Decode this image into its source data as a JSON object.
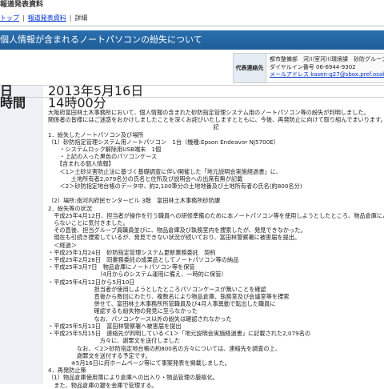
{
  "header": {
    "site_title": "報道発表資料",
    "breadcrumb": [
      "トップ",
      "報道発表資料",
      "詳細"
    ]
  },
  "page_title": "個人情報が含まれるノートパソコンの紛失について",
  "contact": {
    "label": "代表連絡先",
    "lines": [
      "都市整備部　河川室河川環境課　砂防グループ",
      "ダイヤルイン番号 06-6944-9302",
      "メールアドレス kasen-g27@sbox.pref.osaka.lg.jp"
    ]
  },
  "meta": {
    "date_label": "日",
    "date_value": "2013年5月16日",
    "time_label": "時間",
    "time_value": "14時00分"
  },
  "content": [
    "大阪府富田林土木事務所において、個人情報の含まれた砂防指定管理システム用のノートパソコン等の紛失が判明しました。",
    "関係者の皆様にはご迷惑をおかけしましたことを深くお詫びいたしますとともに、今後、再発防止に向けて取り組んでまいります。",
    "記",
    "1．紛失したノートパソコン及び場所",
    "（1）砂防指定管理システム用ノートパソコン　1台（機種:Epson Endeavor NJ5700E）",
    "　　・システムロック解除用USB端末　1個",
    "　　・上記の入った黒色のパソコンケース",
    "　　【含まれる個人情報】",
    "　　＜1＞土砂災害防止法に基づく基礎調査に伴い開催した「地元説明会実施経過書」に、",
    "　　　　土地所有者2,079名分の氏名と住所及び説明会への出席有無が記載",
    "　　＜2＞砂防指定地台帳のデータ中、約2,100筆分の土地地番及び土地所有者の氏名(約800名分)",
    "",
    "（2）場所:南河内府民センタービル 3階　富田林土木事務所砂防課",
    "2．紛失等の状況",
    "　平成25年4月12日、担当者が操作を行う職員への研修準備のために本ノートパソコン等を使用しようとしたところ、物品倉庫にパソコンケースが見当た",
    "　らないことに気付きました。",
    "　その直後、担当グループ員職員並びに、物品倉庫及び執務室内を捜索したが、発見できなかった。",
    "　現在も引続き捜索しているが、発見できない状況が続いており、富田林警察署に被害届を提出。",
    "　＜経過＞",
    "・平成25年1月24日　砂防指定管理システム更新業務委託　契約",
    "・平成25年2月28日　同業務委託の成果品としてノートパソコン等の納品",
    "・平成25年3月7日　物品倉庫にノートパソコン等を保管",
    "　　　　　　　　　（4月からのシステム運用に備え、一時的に保管）",
    "・平成25年4月12日から5月10日",
    "　　　　　　　　担当者が使用しようとしたところパソコンケースが無いことを確認",
    "　　　　　　　　直後から数回にわたり、複数名により物品倉庫、執務室及び会議室等を捜索",
    "　　　　　　　　併せて、富田林土木事務所所管職員及び4月人事異動で転出した職員に",
    "　　　　　　　　確認するも紛失物の発見に至らなかった",
    "　　　　　　　　なお、パソコンケース以外の紛失は確認されなかった",
    "・平成25年5月13日　富田林警察署へ被害届を提出",
    "・平成25年5月15日　連絡先が判明している＜1＞「地元説明会実施経過書」に記載された2,079名の",
    "　　　　　　　　　方々に、謝罪文を送付しました",
    "　　　　　なお、＜2＞砂防指定地台帳の約800名の方々については、連絡先を調査の上、",
    "　　　　　謝罪文を送付する予定です。",
    "　　　　※5月16日に府ホームページ等にて事案発表を掲載しました。",
    "4．再発防止策",
    "（1）物品倉庫使用簿により倉庫への出入り・物品管理の厳格化。",
    "　また、物品倉庫の鍵を金庫で管理する。"
  ]
}
